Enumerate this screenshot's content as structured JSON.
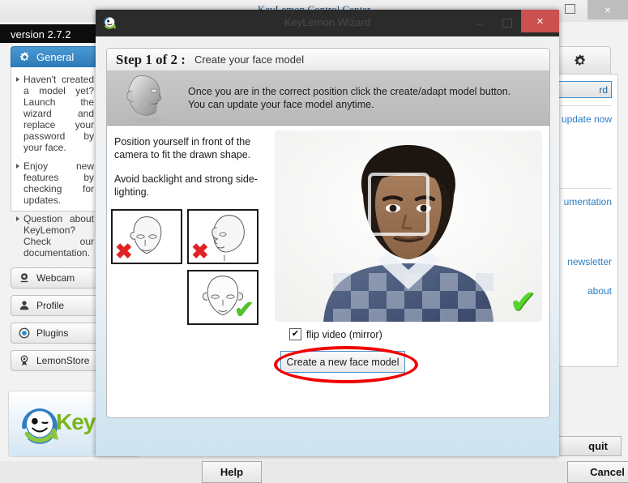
{
  "background_window": {
    "title": "KeyLemon Control Center",
    "version_text": "version 2.7.2",
    "controls": {
      "maximize": "maximize-icon",
      "close": "×"
    },
    "sidebar": {
      "active_tab": {
        "label": "General",
        "icon": "gear-icon"
      },
      "news_items": [
        "Haven't created a model yet? Launch the wizard and replace your password by your face.",
        "Enjoy new features by checking for updates.",
        "Question about KeyLemon? Check our documentation."
      ],
      "buttons": [
        {
          "label": "Webcam",
          "icon": "webcam-icon"
        },
        {
          "label": "Profile",
          "icon": "person-icon"
        },
        {
          "label": "Plugins",
          "icon": "plugin-circle-icon"
        },
        {
          "label": "LemonStore",
          "icon": "ribbon-award-icon"
        }
      ]
    },
    "logo": {
      "text": "Key",
      "icon": "keylemon-winking-face-logo"
    },
    "right_panel": {
      "tab_icon": "gear-icon",
      "wizard_button": "rd",
      "links": [
        "update now",
        "umentation",
        "newsletter",
        "about"
      ],
      "quit_button": "quit"
    }
  },
  "dialog": {
    "title": "KeyLemon Wizard",
    "icon": "keylemon-face-icon",
    "controls": {
      "minimize": "–",
      "maximize": "maximize-icon",
      "close": "×"
    },
    "step": {
      "label": "Step 1 of 2 :",
      "title": "Create your face model"
    },
    "info_banner": {
      "icon": "3d-head-model-icon",
      "line1": "Once you are in the correct position click the create/adapt model button.",
      "line2": "You can update your face model anytime."
    },
    "instructions": [
      "Position yourself in front of the camera to fit the drawn shape.",
      "Avoid backlight and strong side-lighting."
    ],
    "pose_thumbnails": [
      {
        "name": "head-tilted-down",
        "mark": "✖",
        "status": "bad"
      },
      {
        "name": "head-profile-side",
        "mark": "✖",
        "status": "bad"
      },
      {
        "name": "head-frontal-upright",
        "mark": "✔",
        "status": "good"
      }
    ],
    "webcam": {
      "name": "webcam-preview",
      "face_box": "face-detection-box",
      "status_mark": "✔"
    },
    "flip_checkbox": {
      "label": "flip video (mirror)",
      "checked": true,
      "check_glyph": "✔"
    },
    "create_button": {
      "label": "Create a new face model",
      "highlight_color": "#f20000"
    },
    "footer": {
      "help": "Help",
      "cancel": "Cancel"
    }
  }
}
